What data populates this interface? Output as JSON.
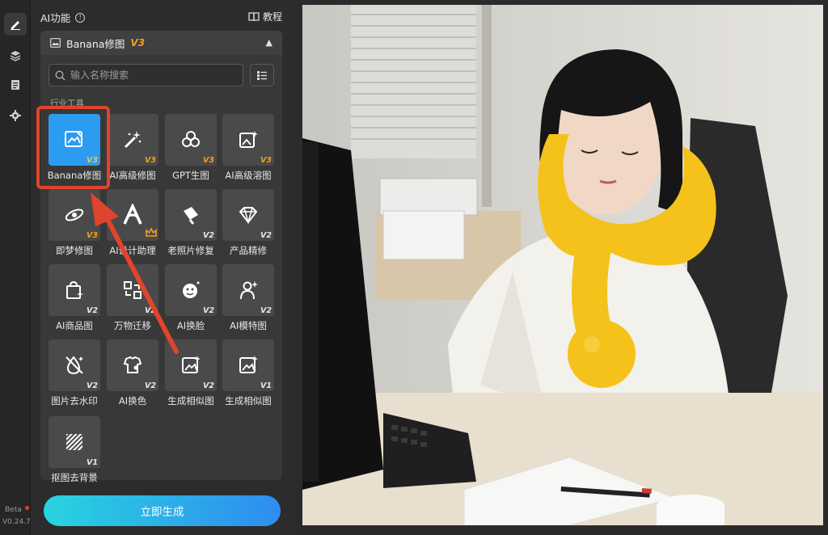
{
  "rail": {
    "beta": "Beta",
    "version": "V0.24.7"
  },
  "panel": {
    "title": "AI功能",
    "tutorial": "教程",
    "card_title": "Banana修图",
    "card_badge": "V3",
    "search_placeholder": "输入名称搜索",
    "section": "行业工具",
    "generate_button": "立即生成"
  },
  "tools": [
    {
      "label": "Banana修图",
      "badge": "V3",
      "icon": "banana-edit-icon"
    },
    {
      "label": "AI高级修图",
      "badge": "V3",
      "icon": "magic-wand-icon"
    },
    {
      "label": "GPT生图",
      "badge": "V3",
      "icon": "gpt-icon"
    },
    {
      "label": "AI高级溶图",
      "badge": "V3",
      "icon": "blend-image-icon"
    },
    {
      "label": "即梦修图",
      "badge": "V3",
      "icon": "jimeng-icon"
    },
    {
      "label": "AI设计助理",
      "badge": "",
      "icon": "design-assistant-icon"
    },
    {
      "label": "老照片修复",
      "badge": "V2",
      "icon": "photo-restore-icon"
    },
    {
      "label": "产品精修",
      "badge": "V2",
      "icon": "diamond-icon"
    },
    {
      "label": "AI商品图",
      "badge": "V2",
      "icon": "shopping-bag-icon"
    },
    {
      "label": "万物迁移",
      "badge": "V2",
      "icon": "transfer-icon"
    },
    {
      "label": "AI换脸",
      "badge": "V2",
      "icon": "face-swap-icon"
    },
    {
      "label": "AI模特图",
      "badge": "V2",
      "icon": "model-icon"
    },
    {
      "label": "图片去水印",
      "badge": "V2",
      "icon": "remove-watermark-icon"
    },
    {
      "label": "AI换色",
      "badge": "V2",
      "icon": "recolor-icon"
    },
    {
      "label": "生成相似图",
      "badge": "V2",
      "icon": "similar-image-icon"
    },
    {
      "label": "生成相似图",
      "badge": "V1",
      "icon": "similar-image-icon"
    },
    {
      "label": "抠图去背景",
      "badge": "V1",
      "icon": "remove-background-icon"
    }
  ],
  "colors": {
    "accent_selected": "#2c9cf0",
    "badge_orange": "#f0a020",
    "highlight_red": "#e0442c"
  }
}
